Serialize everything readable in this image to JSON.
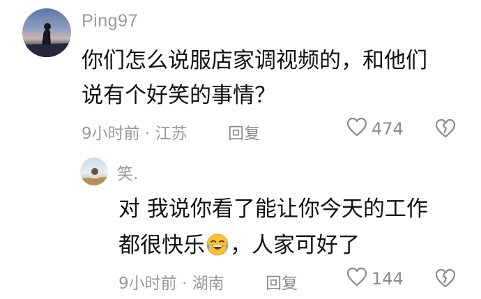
{
  "comment": {
    "author": "Ping97",
    "text_lines": [
      "你们怎么说服店家调视频的，和他们",
      "说有个好笑的事情？"
    ],
    "time_location": "9小时前 · 江苏",
    "reply_label": "回复",
    "like_count": "474",
    "icons": {
      "like": "heart-outline-icon",
      "dislike": "broken-heart-icon"
    }
  },
  "reply": {
    "author": "笑.",
    "text_line1": "对 我说你看了能让你今天的工作",
    "text_line2_before": "都很快乐",
    "emoji": "laughing-crying-emoji",
    "text_line2_after": "，人家可好了",
    "time_location": "9小时前 · 湖南",
    "reply_label": "回复",
    "like_count": "144",
    "icons": {
      "like": "heart-outline-icon",
      "dislike": "broken-heart-icon"
    }
  },
  "colors": {
    "text_primary": "#111111",
    "text_secondary": "#9a9a9a",
    "background": "#ffffff"
  }
}
